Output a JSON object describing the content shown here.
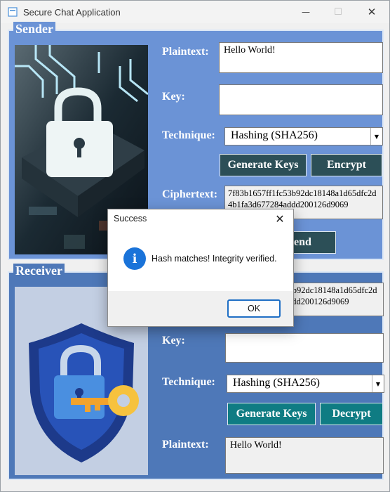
{
  "window": {
    "title": "Secure Chat Application",
    "minimize": "—",
    "maximize": "☐",
    "close": "✕"
  },
  "sender": {
    "legend": "Sender",
    "plaintext_label": "Plaintext:",
    "plaintext_value": "Hello World!",
    "key_label": "Key:",
    "key_value": "",
    "technique_label": "Technique:",
    "technique_value": "Hashing (SHA256)",
    "generate_keys": "Generate Keys",
    "encrypt": "Encrypt",
    "ciphertext_label": "Ciphertext:",
    "ciphertext_value": "7f83b1657ff1fc53b92dc18148a1d65dfc2d4b1fa3d677284addd200126d9069",
    "send": "Send",
    "image": "circuit-padlock-image"
  },
  "receiver": {
    "legend": "Receiver",
    "ciphertext_value": "7f83b1657ff1fc53b92dc18148a1d65dfc2d4b1fa3d677284addd200126d9069",
    "key_label": "Key:",
    "key_value": "",
    "technique_label": "Technique:",
    "technique_value": "Hashing (SHA256)",
    "generate_keys": "Generate Keys",
    "decrypt": "Decrypt",
    "plaintext_label": "Plaintext:",
    "plaintext_value": "Hello World!",
    "image": "shield-lock-key-image"
  },
  "dialog": {
    "title": "Success",
    "close": "✕",
    "icon": "info-icon",
    "message": "Hash matches! Integrity verified.",
    "ok": "OK"
  },
  "colors": {
    "sender_bg": "#6b93d6",
    "receiver_bg": "#4e78b8",
    "sender_button": "#2c4f57",
    "receiver_button": "#0f7c83",
    "info_blue": "#1a73d9"
  }
}
